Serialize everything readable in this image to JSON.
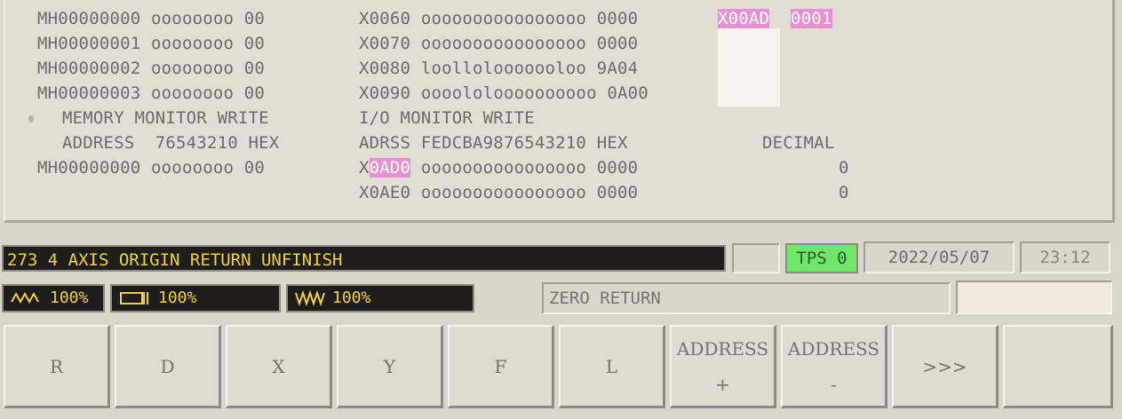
{
  "memory_monitor": {
    "rows": [
      {
        "address": "MH00000000",
        "bits": "oooooooo",
        "hex": "00"
      },
      {
        "address": "MH00000001",
        "bits": "oooooooo",
        "hex": "00"
      },
      {
        "address": "MH00000002",
        "bits": "oooooooo",
        "hex": "00"
      },
      {
        "address": "MH00000003",
        "bits": "oooooooo",
        "hex": "00"
      }
    ],
    "write_title": "MEMORY MONITOR WRITE",
    "write_header": "ADDRESS  76543210 HEX",
    "write_row": {
      "address": "MH00000000",
      "bits": "oooooooo",
      "hex": "00"
    }
  },
  "io_monitor": {
    "rows": [
      {
        "address": "X0060",
        "bits": "oooooooooooooooo",
        "hex": "0000"
      },
      {
        "address": "X0070",
        "bits": "oooooooooooooooo",
        "hex": "0000"
      },
      {
        "address": "X0080",
        "bits": "loollolooooooloo",
        "hex": "9A04"
      },
      {
        "address": "X0090",
        "bits": "oooololoooooooooo",
        "hex": "0A00"
      }
    ],
    "write_title": "I/O MONITOR WRITE",
    "write_header": "ADRSS FEDCBA9876543210 HEX",
    "decimal_header": "DECIMAL",
    "write_rows": [
      {
        "address_prefix": "X",
        "address_highlight": "0AD0",
        "bits": "oooooooooooooooo",
        "hex": "0000",
        "decimal": "0"
      },
      {
        "address": "X0AE0",
        "bits": "oooooooooooooooo",
        "hex": "0000",
        "decimal": "0"
      }
    ],
    "selected_address": "X00AD",
    "selected_value": "0001"
  },
  "status": {
    "alarm": "273 4 AXIS ORIGIN RETURN UNFINISH",
    "tps": "TPS 0",
    "date": "2022/05/07",
    "time": "23:12",
    "mode": "ZERO RETURN"
  },
  "overrides": [
    {
      "icon": "spindle-wave-icon",
      "value": "100%"
    },
    {
      "icon": "rapid-bar-icon",
      "value": "100%"
    },
    {
      "icon": "feed-zigzag-icon",
      "value": "100%"
    }
  ],
  "softkeys": [
    {
      "label": "R",
      "sub": ""
    },
    {
      "label": "D",
      "sub": ""
    },
    {
      "label": "X",
      "sub": ""
    },
    {
      "label": "Y",
      "sub": ""
    },
    {
      "label": "F",
      "sub": ""
    },
    {
      "label": "L",
      "sub": ""
    },
    {
      "label": "ADDRESS",
      "sub": "+"
    },
    {
      "label": "ADDRESS",
      "sub": "-"
    },
    {
      "label": ">>>",
      "sub": ""
    },
    {
      "label": "",
      "sub": ""
    }
  ],
  "colors": {
    "highlight": "#e98fd3",
    "alarm_text": "#f0d23a",
    "tps_green": "#6fe86a"
  }
}
